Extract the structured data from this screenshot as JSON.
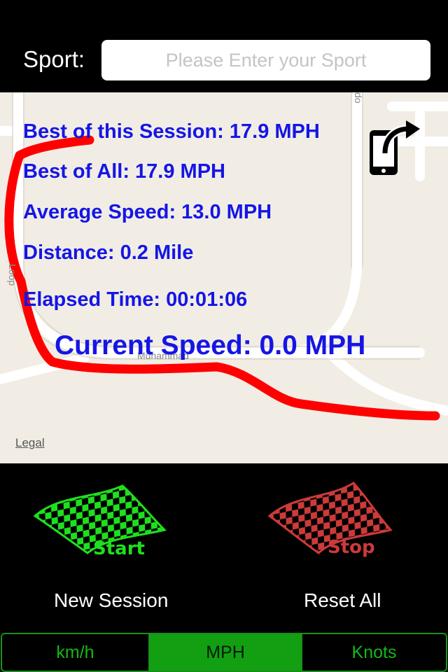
{
  "header": {
    "sport_label": "Sport:",
    "sport_placeholder": "Please Enter your Sport",
    "sport_value": ""
  },
  "map": {
    "stats": {
      "best_session": "Best of this Session: 17.9 MPH",
      "best_all": "Best of All: 17.9 MPH",
      "average_speed": "Average Speed: 13.0 MPH",
      "distance": "Distance: 0.2 Mile",
      "elapsed_time": "Elapsed Time: 00:01:06",
      "current_speed": "Current Speed: 0.0 MPH"
    },
    "street_labels": [
      "Muhammad",
      "Loop",
      "do"
    ],
    "legal": "Legal",
    "share_icon": "share-phone-icon",
    "route_color": "#ff0000",
    "text_color": "#1515e6"
  },
  "controls": {
    "start_flag_label": "Start",
    "stop_flag_label": "Stop",
    "start_color": "#1ee01e",
    "stop_color": "#cc3a3a",
    "new_session": "New Session",
    "reset_all": "Reset All"
  },
  "units": {
    "options": [
      "km/h",
      "MPH",
      "Knots"
    ],
    "selected": "MPH",
    "accent": "#12a012"
  }
}
